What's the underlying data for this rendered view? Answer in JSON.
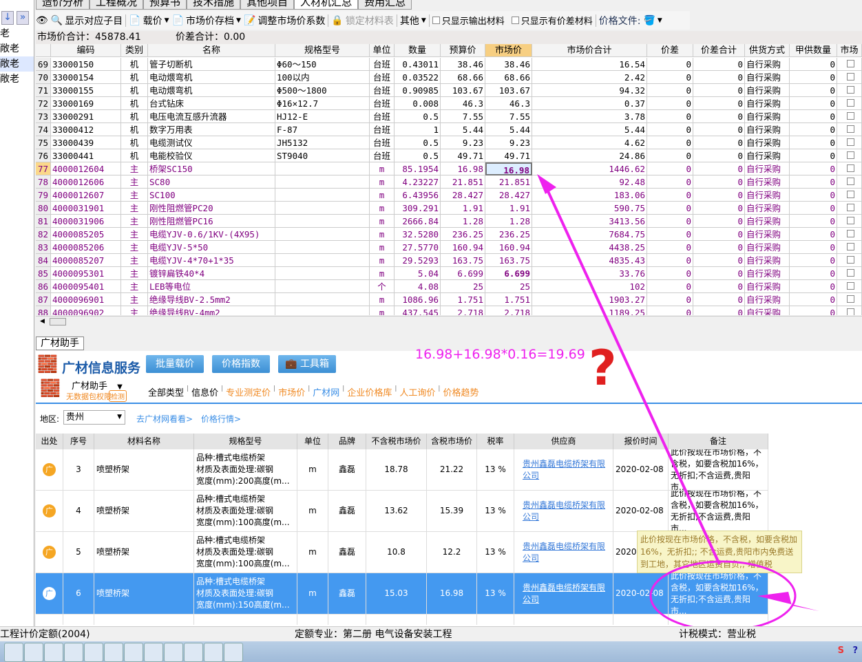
{
  "tabs": [
    "造价分析",
    "工程概况",
    "预算书",
    "技术措施",
    "其他项目",
    "人材机汇总",
    "费用汇总"
  ],
  "active_tab": 5,
  "toolbar": {
    "show_sub": "显示对应子目",
    "load_price": "载价",
    "save_price": "市场价存档",
    "adjust": "调整市场价系数",
    "lock": "锁定材料表",
    "other": "其他",
    "only_output": "只显示输出材料",
    "only_diff": "只显示有价差材料",
    "price_file": "价格文件:"
  },
  "summary": {
    "market_total": "市场价合计：45878.41",
    "diff_total": "价差合计：0.00"
  },
  "sidebar": [
    "老",
    "敞老",
    "敞老",
    "敞老"
  ],
  "grid": {
    "columns": [
      "",
      "编码",
      "类别",
      "名称",
      "规格型号",
      "单位",
      "数量",
      "预算价",
      "市场价",
      "市场价合计",
      "价差",
      "价差合计",
      "供货方式",
      "甲供数量",
      "市场"
    ],
    "rows": [
      [
        "69",
        "33000150",
        "机",
        "管子切断机",
        "Φ60～150",
        "台班",
        "0.43011",
        "38.46",
        "38.46",
        "16.54",
        "0",
        "0",
        "自行采购",
        "0"
      ],
      [
        "70",
        "33000154",
        "机",
        "电动煨弯机",
        "100以内",
        "台班",
        "0.03522",
        "68.66",
        "68.66",
        "2.42",
        "0",
        "0",
        "自行采购",
        "0"
      ],
      [
        "71",
        "33000155",
        "机",
        "电动煨弯机",
        "Φ500～1800",
        "台班",
        "0.90985",
        "103.67",
        "103.67",
        "94.32",
        "0",
        "0",
        "自行采购",
        "0"
      ],
      [
        "72",
        "33000169",
        "机",
        "台式钻床",
        "Φ16×12.7",
        "台班",
        "0.008",
        "46.3",
        "46.3",
        "0.37",
        "0",
        "0",
        "自行采购",
        "0"
      ],
      [
        "73",
        "33000291",
        "机",
        "电压电流互感升流器",
        "HJ12-E",
        "台班",
        "0.5",
        "7.55",
        "7.55",
        "3.78",
        "0",
        "0",
        "自行采购",
        "0"
      ],
      [
        "74",
        "33000412",
        "机",
        "数字万用表",
        "F-87",
        "台班",
        "1",
        "5.44",
        "5.44",
        "5.44",
        "0",
        "0",
        "自行采购",
        "0"
      ],
      [
        "75",
        "33000439",
        "机",
        "电缆测试仪",
        "JH5132",
        "台班",
        "0.5",
        "9.23",
        "9.23",
        "4.62",
        "0",
        "0",
        "自行采购",
        "0"
      ],
      [
        "76",
        "33000441",
        "机",
        "电能校验仪",
        "ST9040",
        "台班",
        "0.5",
        "49.71",
        "49.71",
        "24.86",
        "0",
        "0",
        "自行采购",
        "0"
      ],
      [
        "77",
        "4000012604",
        "主",
        "桥架SC150",
        "",
        "m",
        "85.1954",
        "16.98",
        "16.98",
        "1446.62",
        "0",
        "0",
        "自行采购",
        "0"
      ],
      [
        "78",
        "4000012606",
        "主",
        "SC80",
        "",
        "m",
        "4.23227",
        "21.851",
        "21.851",
        "92.48",
        "0",
        "0",
        "自行采购",
        "0"
      ],
      [
        "79",
        "4000012607",
        "主",
        "SC100",
        "",
        "m",
        "6.43956",
        "28.427",
        "28.427",
        "183.06",
        "0",
        "0",
        "自行采购",
        "0"
      ],
      [
        "80",
        "4000031901",
        "主",
        "刚性阻燃管PC20",
        "",
        "m",
        "309.291",
        "1.91",
        "1.91",
        "590.75",
        "0",
        "0",
        "自行采购",
        "0"
      ],
      [
        "81",
        "4000031906",
        "主",
        "刚性阻燃管PC16",
        "",
        "m",
        "2666.84",
        "1.28",
        "1.28",
        "3413.56",
        "0",
        "0",
        "自行采购",
        "0"
      ],
      [
        "82",
        "4000085205",
        "主",
        "电缆YJV-0.6/1KV-(4X95)",
        "",
        "m",
        "32.5280",
        "236.25",
        "236.25",
        "7684.75",
        "0",
        "0",
        "自行采购",
        "0"
      ],
      [
        "83",
        "4000085206",
        "主",
        "电缆YJV-5*50",
        "",
        "m",
        "27.5770",
        "160.94",
        "160.94",
        "4438.25",
        "0",
        "0",
        "自行采购",
        "0"
      ],
      [
        "84",
        "4000085207",
        "主",
        "电缆YJV-4*70+1*35",
        "",
        "m",
        "29.5293",
        "163.75",
        "163.75",
        "4835.43",
        "0",
        "0",
        "自行采购",
        "0"
      ],
      [
        "85",
        "4000095301",
        "主",
        "镀锌扁铁40*4",
        "",
        "m",
        "5.04",
        "6.699",
        "6.699",
        "33.76",
        "0",
        "0",
        "自行采购",
        "0"
      ],
      [
        "86",
        "4000095401",
        "主",
        "LEB等电位",
        "",
        "个",
        "4.08",
        "25",
        "25",
        "102",
        "0",
        "0",
        "自行采购",
        "0"
      ],
      [
        "87",
        "4000096901",
        "主",
        "绝缘导线BV-2.5mm2",
        "",
        "m",
        "1086.96",
        "1.751",
        "1.751",
        "1903.27",
        "0",
        "0",
        "自行采购",
        "0"
      ],
      [
        "88",
        "4000096902",
        "主",
        "绝缘导线BV-4mm2",
        "",
        "m",
        "437.545",
        "2.718",
        "2.718",
        "1189.25",
        "0",
        "0",
        "自行采购",
        "0"
      ]
    ]
  },
  "panel": {
    "tab": "广材助手",
    "brand": "广材信息服务",
    "btn_batch": "批量载价",
    "btn_index": "价格指数",
    "btn_tools": "工具箱",
    "assistant": "广材助手",
    "no_perm": "无数据包权限",
    "check": "检测",
    "categories": [
      "全部类型",
      "信息价",
      "专业测定价",
      "市场价",
      "广材网",
      "企业价格库",
      "人工询价",
      "价格趋势"
    ],
    "region_label": "地区:",
    "region": "贵州",
    "go_site": "去广材网看看>",
    "market": "价格行情>"
  },
  "btable": {
    "columns": [
      "出处",
      "序号",
      "材料名称",
      "规格型号",
      "单位",
      "品牌",
      "不含税市场价",
      "含税市场价",
      "税率",
      "供应商",
      "报价时间",
      "备注"
    ],
    "rows": [
      {
        "src": "广",
        "no": "3",
        "name": "喷塑桥架",
        "spec": [
          "品种:槽式电缆桥架",
          "材质及表面处理:碳钢",
          "宽度(mm):200高度(m..."
        ],
        "unit": "m",
        "brand": "鑫磊",
        "ex": "18.78",
        "inc": "21.22",
        "tax": "13 %",
        "supplier": "贵州鑫磊电缆桥架有限公司",
        "date": "2020-02-08",
        "note": [
          "此价按现在市场价格，不",
          "含税，如要含税加16%，",
          "无折扣;不含运费,贵阳市..."
        ]
      },
      {
        "src": "广",
        "no": "4",
        "name": "喷塑桥架",
        "spec": [
          "品种:槽式电缆桥架",
          "材质及表面处理:碳钢",
          "宽度(mm):100高度(m..."
        ],
        "unit": "m",
        "brand": "鑫磊",
        "ex": "13.62",
        "inc": "15.39",
        "tax": "13 %",
        "supplier": "贵州鑫磊电缆桥架有限公司",
        "date": "2020-02-08",
        "note": [
          "此价按现在市场价格，不",
          "含税，如要含税加16%，",
          "无折扣;不含运费,贵阳市..."
        ]
      },
      {
        "src": "广",
        "no": "5",
        "name": "喷塑桥架",
        "spec": [
          "品种:槽式电缆桥架",
          "材质及表面处理:碳钢",
          "宽度(mm):100高度(m..."
        ],
        "unit": "m",
        "brand": "鑫磊",
        "ex": "10.8",
        "inc": "12.2",
        "tax": "13 %",
        "supplier": "贵州鑫磊电缆桥架有限公司",
        "date": "2020-02-08",
        "note": [
          "此价按现在市场价格，不",
          "含税，如要含税加16%，",
          "无折扣;不含运费,贵阳市..."
        ]
      },
      {
        "src": "广",
        "no": "6",
        "name": "喷塑桥架",
        "spec": [
          "品种:槽式电缆桥架",
          "材质及表面处理:碳钢",
          "宽度(mm):150高度(m..."
        ],
        "unit": "m",
        "brand": "鑫磊",
        "ex": "15.03",
        "inc": "16.98",
        "tax": "13 %",
        "supplier": "贵州鑫磊电缆桥架有限公司",
        "date": "2020-02-08",
        "note": [
          "此价按现在市场价格，不",
          "含税，如要含税加16%，",
          "无折扣;不含运费,贵阳市..."
        ]
      }
    ]
  },
  "tooltip": "此价按现在市场价格，不含税，如要含税加16%，无折扣;; 不含运费,贵阳市内免费送到工地，其它地区运费自负;; 增值税",
  "annotation": {
    "formula": "16.98+16.98*0.16=19.69",
    "mark": "?",
    "color": "#ee22ee"
  },
  "status": {
    "left": "工程计价定额(2004)",
    "mid": "定额专业：第二册 电气设备安装工程",
    "right": "计税模式：营业税"
  }
}
